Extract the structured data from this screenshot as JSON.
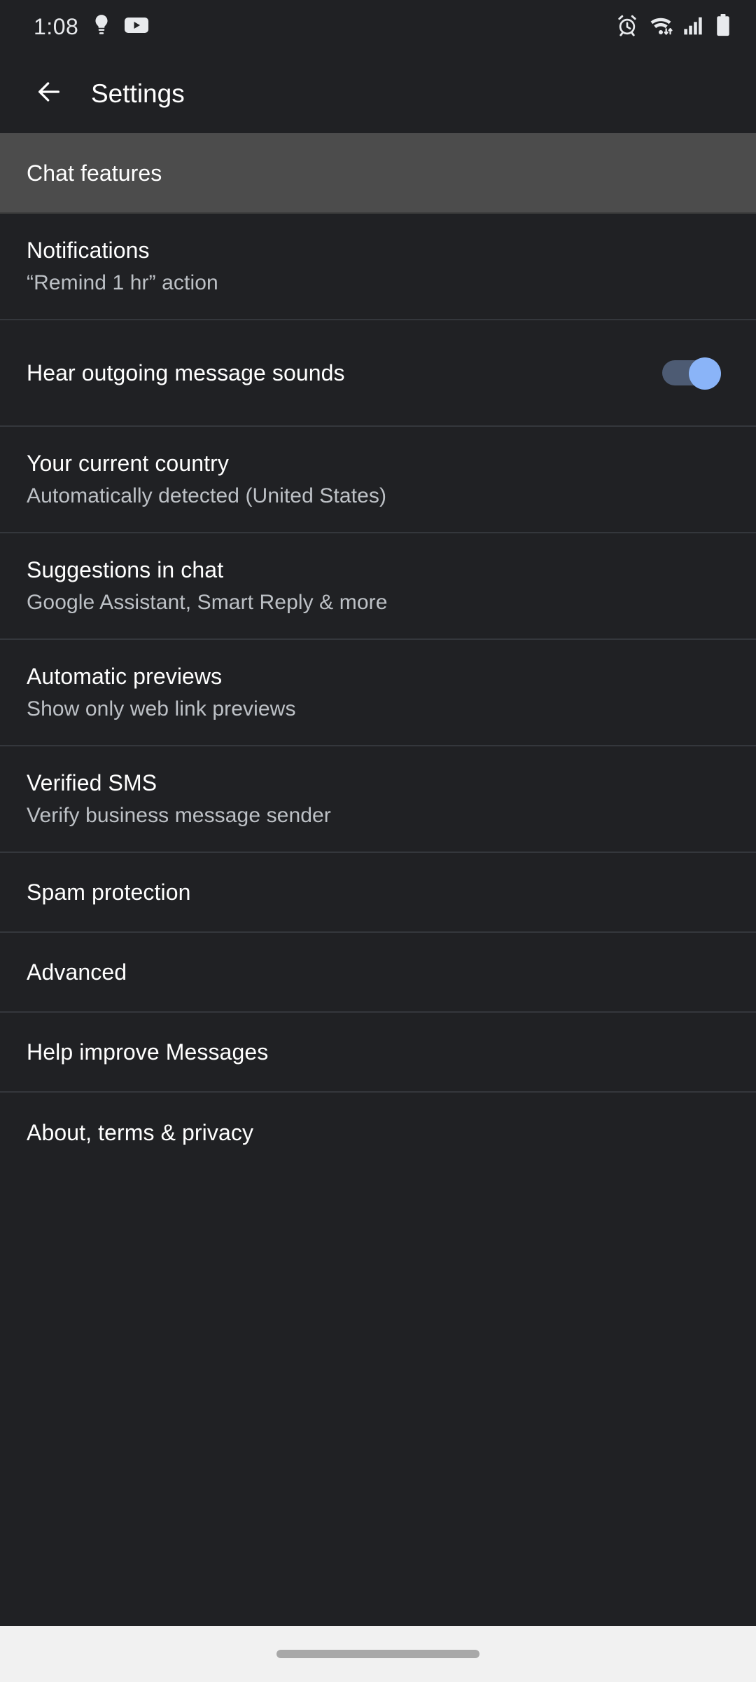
{
  "status_bar": {
    "time": "1:08",
    "left_icons": [
      "lightbulb-icon",
      "youtube-icon"
    ],
    "right_icons": [
      "alarm-icon",
      "wifi-icon",
      "cellular-signal-icon",
      "battery-icon"
    ]
  },
  "app_bar": {
    "back_icon": "back-arrow-icon",
    "title": "Settings"
  },
  "colors": {
    "background": "#202124",
    "highlight_row": "#4c4c4c",
    "divider": "#34373c",
    "title_text": "#ffffff",
    "subtitle_text": "#bdc1c6",
    "switch_thumb_on": "#8ab4f8",
    "switch_track_on": "#4d5b73",
    "nav_bar": "#f1f1f1",
    "gesture_pill": "#a8a8a8"
  },
  "settings": {
    "items": [
      {
        "title": "Chat features",
        "subtitle": "",
        "highlighted": true,
        "has_switch": false
      },
      {
        "title": "Notifications",
        "subtitle": "“Remind 1 hr” action",
        "highlighted": false,
        "has_switch": false
      },
      {
        "title": "Hear outgoing message sounds",
        "subtitle": "",
        "highlighted": false,
        "has_switch": true,
        "switch_state": "on"
      },
      {
        "title": "Your current country",
        "subtitle": "Automatically detected (United States)",
        "highlighted": false,
        "has_switch": false
      },
      {
        "title": "Suggestions in chat",
        "subtitle": "Google Assistant, Smart Reply & more",
        "highlighted": false,
        "has_switch": false
      },
      {
        "title": "Automatic previews",
        "subtitle": "Show only web link previews",
        "highlighted": false,
        "has_switch": false
      },
      {
        "title": "Verified SMS",
        "subtitle": "Verify business message sender",
        "highlighted": false,
        "has_switch": false
      },
      {
        "title": "Spam protection",
        "subtitle": "",
        "highlighted": false,
        "has_switch": false
      },
      {
        "title": "Advanced",
        "subtitle": "",
        "highlighted": false,
        "has_switch": false
      },
      {
        "title": "Help improve Messages",
        "subtitle": "",
        "highlighted": false,
        "has_switch": false
      },
      {
        "title": "About, terms & privacy",
        "subtitle": "",
        "highlighted": false,
        "has_switch": false
      }
    ]
  },
  "navigation_bar": {
    "gesture_pill": "home-gesture-pill"
  }
}
